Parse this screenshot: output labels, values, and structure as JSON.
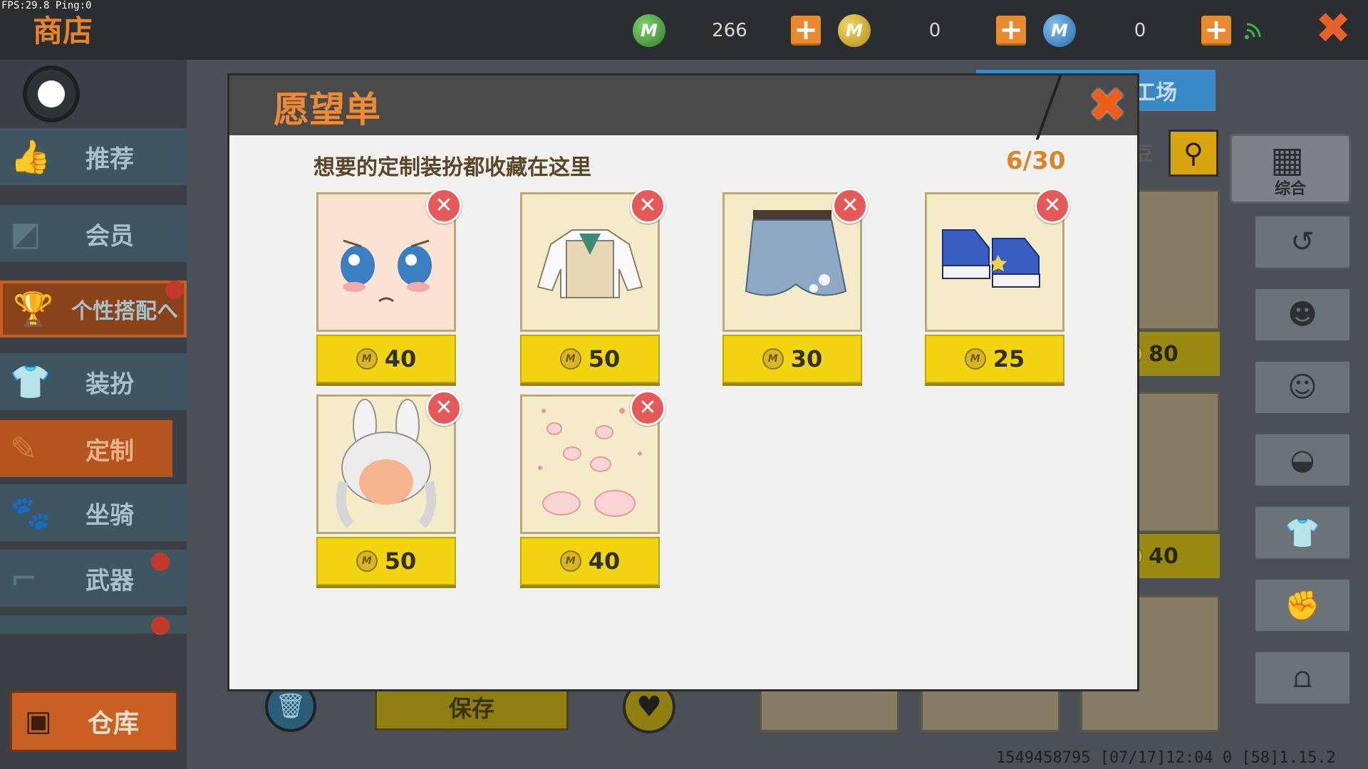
{
  "hud": {
    "fps_ping": "FPS:29.8  Ping:0",
    "shop_title": "商店",
    "currencies": [
      {
        "name": "green-m-coin",
        "value": "266",
        "color": "#3d9a3a"
      },
      {
        "name": "gold-m-coin",
        "value": "0",
        "color": "#c9a21f"
      },
      {
        "name": "blue-m-coin",
        "value": "0",
        "color": "#3f86c8"
      }
    ],
    "close_glyph": "✖"
  },
  "sidebar": {
    "items": [
      {
        "label": "推荐",
        "icon": "thumbs-up-icon"
      },
      {
        "label": "会员",
        "icon": "vip-icon"
      },
      {
        "label": "个性搭配へ",
        "icon": "trophy-icon"
      },
      {
        "label": "装扮",
        "icon": "shirt-icon"
      },
      {
        "label": "定制",
        "icon": "pencil-icon"
      },
      {
        "label": "坐骑",
        "icon": "mount-icon"
      },
      {
        "label": "武器",
        "icon": "gun-icon"
      }
    ],
    "warehouse_label": "仓库"
  },
  "background": {
    "workshop_tab": "工场",
    "bean_label": "豆",
    "all_label": "综合",
    "prices": [
      "80",
      "40"
    ],
    "save_label": "保存",
    "footer": "1549458795  [07/17]12:04 0  [58]1.15.2"
  },
  "wishlist": {
    "title": "愿望单",
    "subtitle": "想要的定制装扮都收藏在这里",
    "count": "6/30",
    "items": [
      {
        "name": "blushing-face",
        "price": "40"
      },
      {
        "name": "sweater-vest-shirt",
        "price": "50"
      },
      {
        "name": "floral-shorts",
        "price": "30"
      },
      {
        "name": "blue-sneakers",
        "price": "25"
      },
      {
        "name": "bunny-ear-hair",
        "price": "50"
      },
      {
        "name": "paw-print-effect",
        "price": "40"
      }
    ],
    "coin_glyph": "M",
    "remove_glyph": "✕"
  }
}
